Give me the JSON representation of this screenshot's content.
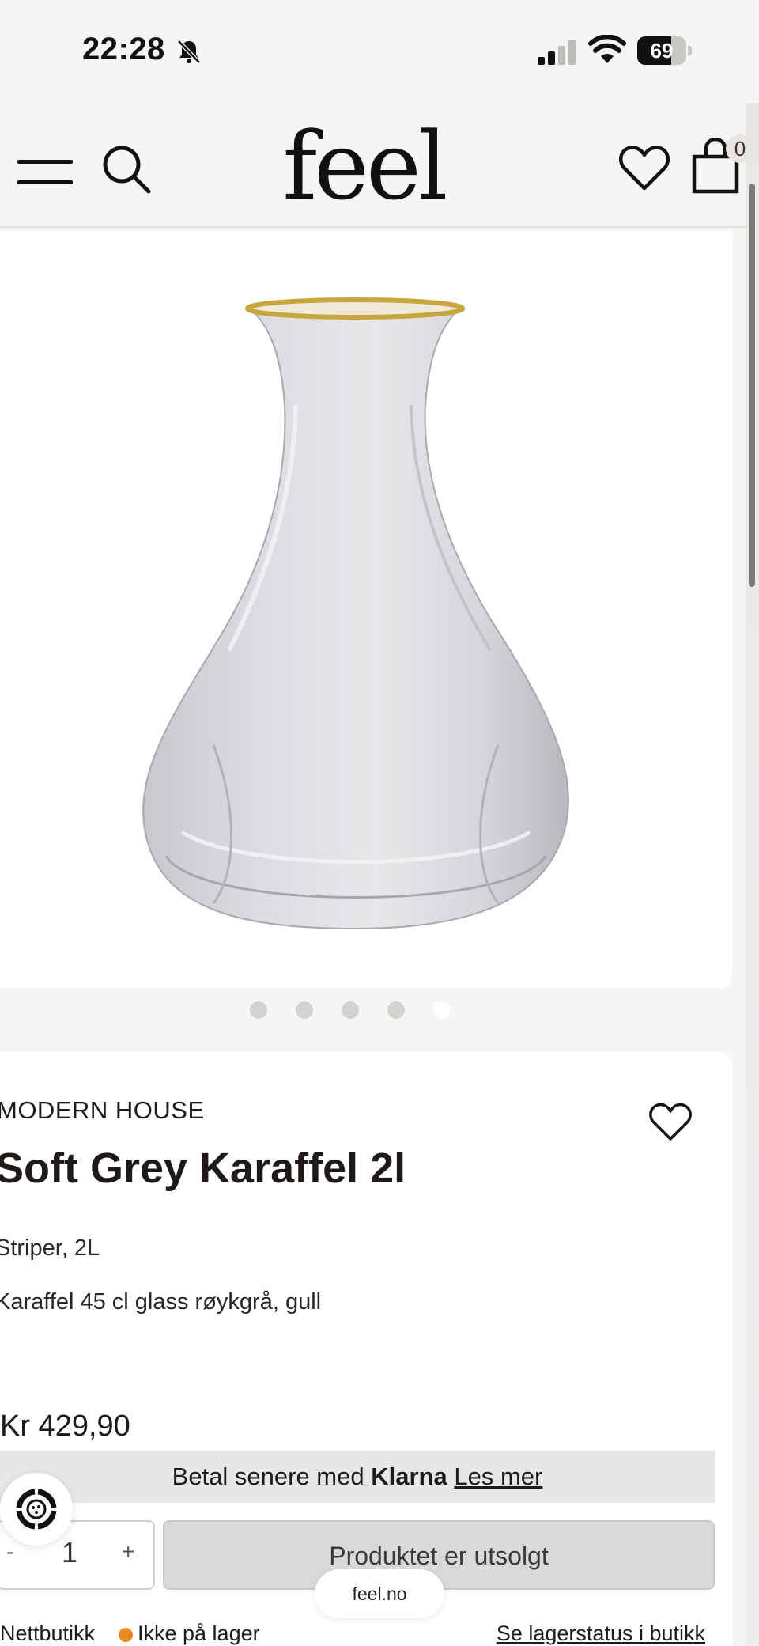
{
  "status_bar": {
    "time": "22:28",
    "battery": "69",
    "battery_level": 0.69
  },
  "header": {
    "logo": "feel",
    "cart_count": "0"
  },
  "gallery": {
    "dots": 5,
    "active_index": 4
  },
  "product": {
    "brand": "MODERN HOUSE",
    "title": "Soft Grey Karaffel 2l",
    "variant": "Striper, 2L",
    "description": "Karaffel 45 cl glass røykgrå, gull",
    "price": "Kr 429,90"
  },
  "klarna": {
    "text": "Betal senere med",
    "brand": "Klarna",
    "link": "Les mer"
  },
  "purchase": {
    "minus": "-",
    "quantity": "1",
    "plus": "+",
    "button": "Produktet er utsolgt"
  },
  "stock": {
    "channel": "Nettbutikk",
    "status": "Ikke på lager",
    "status_color": "#e98a24",
    "link": "Se lagerstatus i butikk"
  },
  "browser": {
    "url": "feel.no"
  }
}
